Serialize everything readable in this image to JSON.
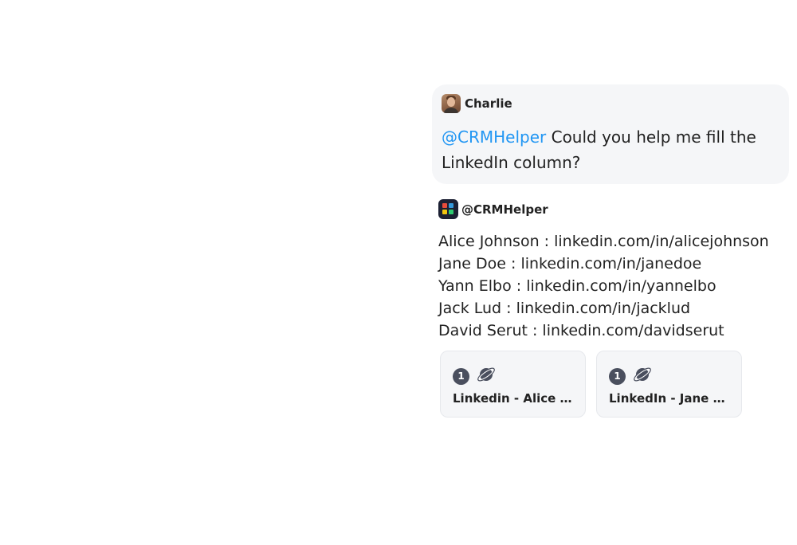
{
  "user_message": {
    "sender": "Charlie",
    "mention": "@CRMHelper",
    "text": "Could you help me fill the LinkedIn column?"
  },
  "bot_message": {
    "sender": "@CRMHelper",
    "lines": [
      "Alice Johnson : linkedin.com/in/alicejohnson",
      "Jane Doe : linkedin.com/in/janedoe",
      "Yann Elbo : linkedin.com/in/yannelbo",
      "Jack Lud : linkedin.com/in/jacklud",
      "David Serut : linkedin.com/davidserut"
    ],
    "sources": [
      {
        "count": "1",
        "icon": "planet-icon",
        "title": "Linkedin - Alice Johnson"
      },
      {
        "count": "1",
        "icon": "planet-icon",
        "title": "LinkedIn - Jane Doe"
      }
    ]
  },
  "colors": {
    "mention": "#2196f3",
    "bubble_bg": "#f5f6f8",
    "badge_bg": "#4a4f5e"
  }
}
